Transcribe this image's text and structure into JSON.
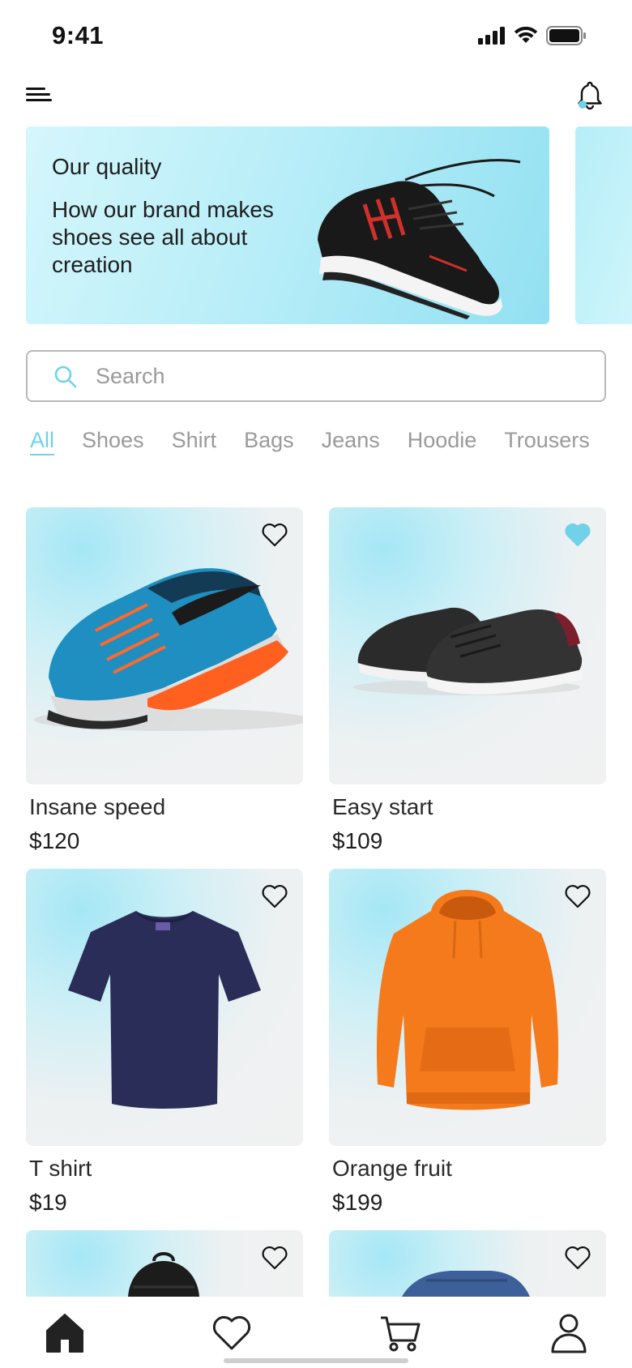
{
  "status_bar": {
    "time": "9:41"
  },
  "banner": {
    "title": "Our quality",
    "text": "How our brand makes shoes see all about creation"
  },
  "search": {
    "placeholder": "Search"
  },
  "categories": [
    "All",
    "Shoes",
    "Shirt",
    "Bags",
    "Jeans",
    "Hoodie",
    "Trousers"
  ],
  "active_category": "All",
  "products": [
    {
      "name": "Insane speed",
      "price": "$120",
      "favorited": false,
      "image": "blue-running-shoe"
    },
    {
      "name": "Easy start",
      "price": "$109",
      "favorited": true,
      "image": "black-sneakers-pair"
    },
    {
      "name": "T shirt",
      "price": "$19",
      "favorited": false,
      "image": "navy-t-shirt"
    },
    {
      "name": "Orange fruit",
      "price": "$199",
      "favorited": false,
      "image": "orange-hoodie"
    },
    {
      "name": "",
      "price": "",
      "favorited": false,
      "image": "black-backpack"
    },
    {
      "name": "",
      "price": "",
      "favorited": false,
      "image": "blue-jeans"
    }
  ],
  "tab_bar": {
    "tabs": [
      "home-icon",
      "heart-icon",
      "cart-icon",
      "profile-icon"
    ],
    "active": "home-icon"
  },
  "colors": {
    "accent": "#6fd2e8",
    "text": "#1e1e1e",
    "muted": "#9a9a9a"
  }
}
